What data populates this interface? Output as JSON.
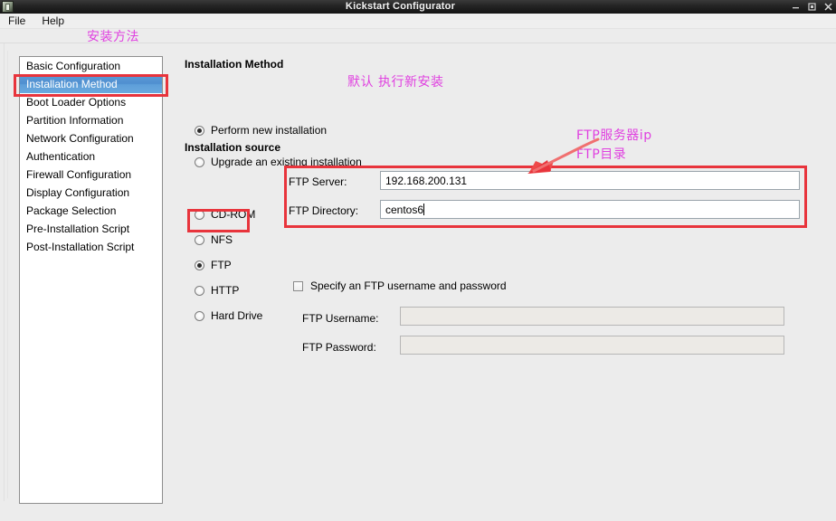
{
  "window": {
    "title": "Kickstart Configurator",
    "app_icon": "app-icon",
    "controls": {
      "minimize": "minimize-icon",
      "maximize": "maximize-icon",
      "close": "close-icon"
    }
  },
  "menubar": {
    "items": [
      {
        "label": "File"
      },
      {
        "label": "Help"
      }
    ]
  },
  "sidebar": {
    "items": [
      {
        "label": "Basic Configuration",
        "selected": false
      },
      {
        "label": "Installation Method",
        "selected": true
      },
      {
        "label": "Boot Loader Options",
        "selected": false
      },
      {
        "label": "Partition Information",
        "selected": false
      },
      {
        "label": "Network Configuration",
        "selected": false
      },
      {
        "label": "Authentication",
        "selected": false
      },
      {
        "label": "Firewall Configuration",
        "selected": false
      },
      {
        "label": "Display Configuration",
        "selected": false
      },
      {
        "label": "Package Selection",
        "selected": false
      },
      {
        "label": "Pre-Installation Script",
        "selected": false
      },
      {
        "label": "Post-Installation Script",
        "selected": false
      }
    ]
  },
  "main": {
    "method_section": {
      "title": "Installation Method",
      "options": [
        {
          "label": "Perform new installation",
          "selected": true
        },
        {
          "label": "Upgrade an existing installation",
          "selected": false
        }
      ]
    },
    "source_section": {
      "title": "Installation source",
      "options": [
        {
          "label": "CD-ROM",
          "selected": false
        },
        {
          "label": "NFS",
          "selected": false
        },
        {
          "label": "FTP",
          "selected": true
        },
        {
          "label": "HTTP",
          "selected": false
        },
        {
          "label": "Hard Drive",
          "selected": false
        }
      ]
    },
    "ftp": {
      "server_label": "FTP Server:",
      "server_value": "192.168.200.131",
      "directory_label": "FTP Directory:",
      "directory_value": "centos6",
      "specify_checkbox_label": "Specify an FTP username and password",
      "specify_checkbox_checked": false,
      "username_label": "FTP Username:",
      "username_value": "",
      "password_label": "FTP Password:",
      "password_value": ""
    }
  },
  "annotations": {
    "method_note": "安装方法",
    "default_note": "默认 执行新安装",
    "server_note": "FTP服务器ip",
    "directory_note": "FTP目录",
    "arrow": "red-arrow-icon",
    "highlight_color": "#e8343c",
    "note_color": "#e040e0"
  }
}
